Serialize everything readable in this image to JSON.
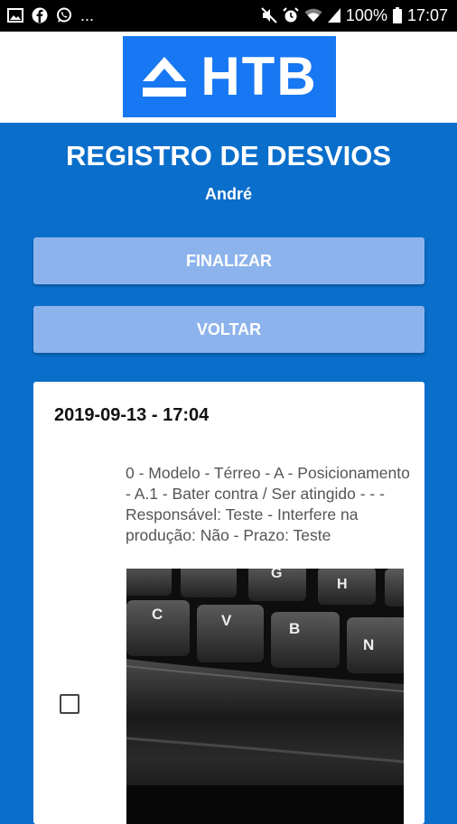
{
  "status_bar": {
    "left_icons": [
      "image-icon",
      "facebook-icon",
      "whatsapp-icon"
    ],
    "more": "...",
    "right_icons": [
      "mute-icon",
      "alarm-icon",
      "wifi-icon",
      "signal-icon"
    ],
    "battery": "100%",
    "time": "17:07"
  },
  "header": {
    "logo_text": "HTB"
  },
  "page": {
    "title": "REGISTRO DE DESVIOS",
    "user": "André"
  },
  "actions": {
    "finalize": "FINALIZAR",
    "back": "VOLTAR"
  },
  "record": {
    "datetime": "2019-09-13 - 17:04",
    "description": "0 - Modelo - Térreo - A - Posicionamento - A.1 - Bater contra / Ser atingido - - - Responsável: Teste - Interfere na produção: Não - Prazo: Teste",
    "photo_keys": [
      "G",
      "H",
      "C",
      "V",
      "B",
      "N"
    ],
    "checked": false
  },
  "colors": {
    "background": "#0a6ecb",
    "logo": "#1877f2",
    "button": "#8db3ec"
  }
}
